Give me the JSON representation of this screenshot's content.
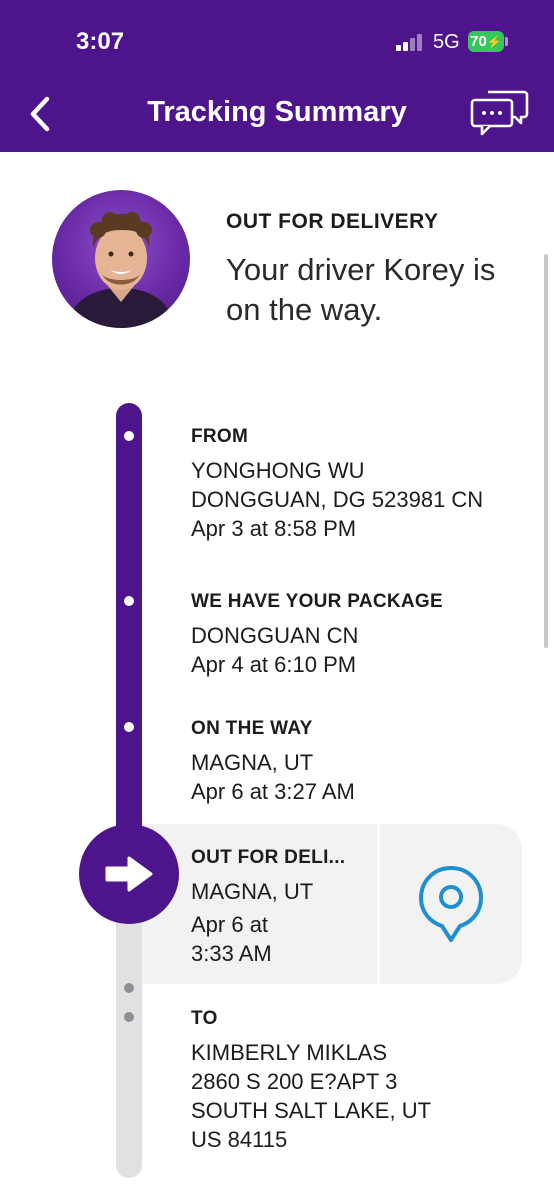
{
  "status_bar": {
    "time": "3:07",
    "network": "5G",
    "battery": "70"
  },
  "header": {
    "title": "Tracking Summary"
  },
  "delivery": {
    "status": "OUT FOR DELIVERY",
    "message": "Your driver Korey is on the way."
  },
  "events": [
    {
      "title": "FROM",
      "lines": [
        "YONGHONG WU",
        "DONGGUAN, DG 523981 CN",
        "Apr 3 at 8:58 PM"
      ]
    },
    {
      "title": "WE HAVE YOUR PACKAGE",
      "lines": [
        "DONGGUAN CN",
        "Apr 4 at 6:10 PM"
      ]
    },
    {
      "title": "ON THE WAY",
      "lines": [
        "MAGNA, UT",
        "Apr 6 at 3:27 AM"
      ]
    },
    {
      "title": "OUT FOR DELI...",
      "lines": [
        "MAGNA, UT",
        "Apr 6 at",
        "3:33 AM"
      ]
    },
    {
      "title": "TO",
      "lines": [
        "KIMBERLY MIKLAS",
        "2860 S 200 E?APT 3",
        "SOUTH SALT LAKE, UT",
        "US 84115"
      ]
    }
  ],
  "colors": {
    "brand_purple": "#4d148c",
    "pin_blue": "#1e8fd0",
    "battery_green": "#34c759"
  },
  "icons": {
    "back": "chevron-left-icon",
    "chat": "chat-bubbles-icon",
    "current": "arrow-right-icon",
    "location": "location-pin-icon"
  }
}
